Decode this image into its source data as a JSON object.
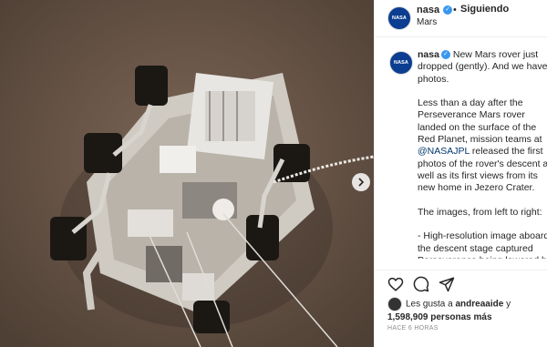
{
  "post": {
    "account": "nasa",
    "follow_label": "Siguiendo",
    "dot": "•",
    "location": "Mars",
    "avatar_text": "NASA",
    "verified_mark": "✓"
  },
  "caption": {
    "username": "nasa",
    "headline": " New Mars rover just dropped (gently). And we have photos.",
    "para1_a": "Less than a day after the Perseverance Mars rover landed on the surface of the Red Planet, mission teams at ",
    "para1_mention": "@NASAJPL",
    "para1_b": " released the first photos of the rover's descent as well as its first views from its new home in Jezero Crater.",
    "para2": "The images, from left to right:",
    "para3": "- High-resolution image aboard the descent stage captured Perseverance being lowered by its skycrane\n- Perseverance's first full-color image of Mars sent back by the rover's Hazard Cameras on the spacecraft"
  },
  "actions": {
    "like_icon": "heart-icon",
    "comment_icon": "comment-icon",
    "share_icon": "paper-plane-icon"
  },
  "likes": {
    "prefix": "Les gusta a ",
    "user": "andreaaide",
    "mid": " y",
    "count": "1,598,909 personas más"
  },
  "timestamp": "HACE 6 HORAS",
  "colors": {
    "verified": "#3897f0",
    "mention": "#00376b",
    "nasa_blue": "#0b3d91"
  }
}
